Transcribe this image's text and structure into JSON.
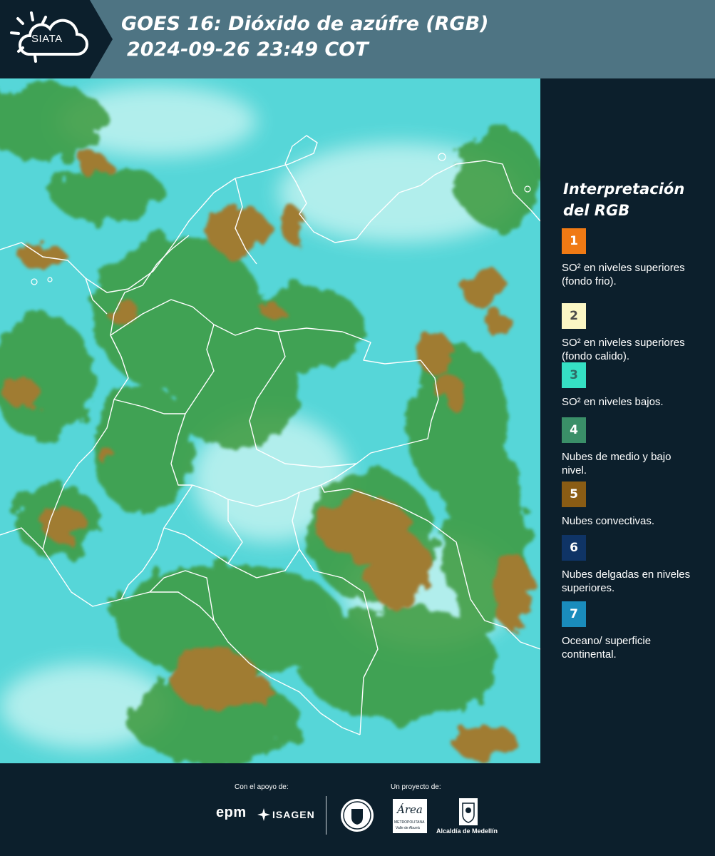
{
  "header": {
    "logo_text": "SIATA",
    "title_line1": "GOES 16: Dióxido de azúfre (RGB)",
    "title_line2": "2024-09-26 23:49 COT"
  },
  "legend": {
    "title": "Interpretación del RGB",
    "items": [
      {
        "number": "1",
        "label": "SO² en niveles superiores (fondo frio).",
        "color": "#f07a14",
        "text_color": "#ffffff"
      },
      {
        "number": "2",
        "label": "SO² en niveles superiores (fondo calido).",
        "color": "#fbf6c4",
        "text_color": "#4a4a4a"
      },
      {
        "number": "3",
        "label": "SO² en niveles bajos.",
        "color": "#35e0c4",
        "text_color": "#2f6b66"
      },
      {
        "number": "4",
        "label": "Nubes de medio y bajo nivel.",
        "color": "#3a8f68",
        "text_color": "#ffffff"
      },
      {
        "number": "5",
        "label": "Nubes convectivas.",
        "color": "#8a5c14",
        "text_color": "#ffffff"
      },
      {
        "number": "6",
        "label": "Nubes delgadas en niveles superiores.",
        "color": "#0f3466",
        "text_color": "#ffffff"
      },
      {
        "number": "7",
        "label": "Oceano/ superficie continental.",
        "color": "#1a8cbc",
        "text_color": "#ffffff"
      }
    ]
  },
  "footer": {
    "support_label": "Con el apoyo de:",
    "project_label": "Un proyecto de:",
    "epm": "epm",
    "isagen": "ISAGEN",
    "area_text": "Área",
    "area_sub1": "METROPOLITANA",
    "area_sub2": "Valle de Aburrá",
    "alcaldia": "Alcaldía de Medellín"
  },
  "colors": {
    "background": "#0c1f2c",
    "header": "#4e7483",
    "ocean_cyan": "#56d6d8",
    "vegetation_green": "#3c9a3e",
    "convective_brown": "#9a7a2e"
  }
}
